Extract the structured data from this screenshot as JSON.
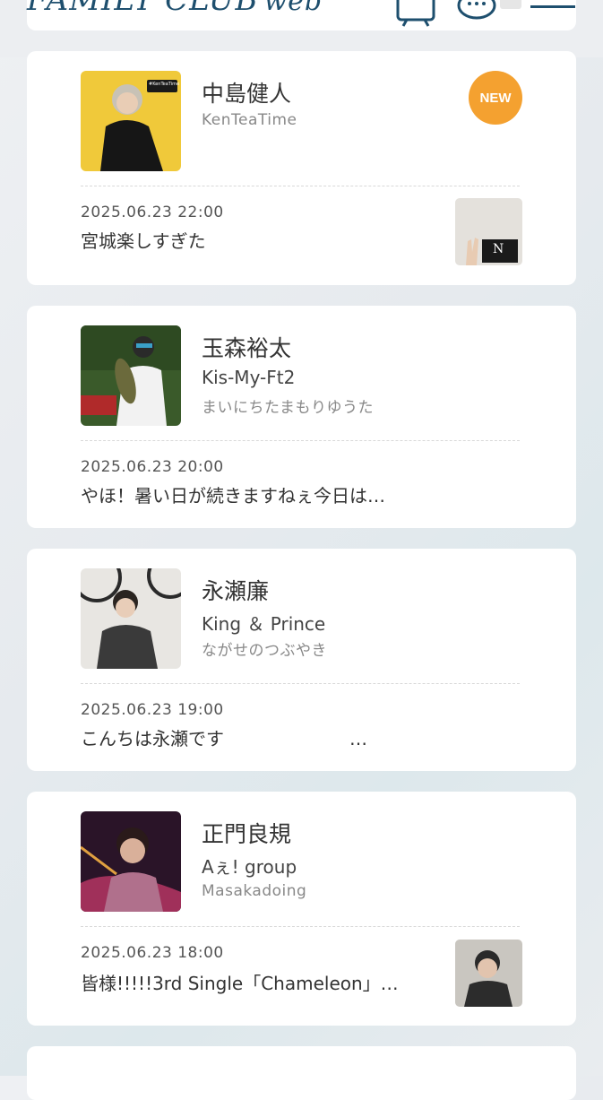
{
  "header": {
    "logo_main": "FAMILY CLUB",
    "logo_sub": "web",
    "icons": [
      "tv-icon",
      "chat-icon",
      "menu-icon"
    ]
  },
  "colors": {
    "logo": "#1e4f6e",
    "new_badge": "#f4a130"
  },
  "entries": [
    {
      "name": "中島健人",
      "group": "",
      "blog": "KenTeaTime",
      "badge": "NEW",
      "date": "2025.06.23 22:00",
      "title": "宮城楽しすぎた",
      "avatar_tag": "#KenTeaTime",
      "thumbnail_text": "N"
    },
    {
      "name": "玉森裕太",
      "group": "Kis-My-Ft2",
      "blog": "まいにちたまもりゆうた",
      "date": "2025.06.23 20:00",
      "title": "やほ！暑い日が続きますねぇ今日は…"
    },
    {
      "name": "永瀬廉",
      "group": "King ＆ Prince",
      "blog": "ながせのつぶやき",
      "date": "2025.06.23 19:00",
      "title": "こんちは永瀬です　　　　　　　…"
    },
    {
      "name": "正門良規",
      "group": "Aぇ! group",
      "blog": "Masakadoing",
      "date": "2025.06.23 18:00",
      "title": "皆様!!!!!3rd Single「Chameleon」…"
    }
  ]
}
